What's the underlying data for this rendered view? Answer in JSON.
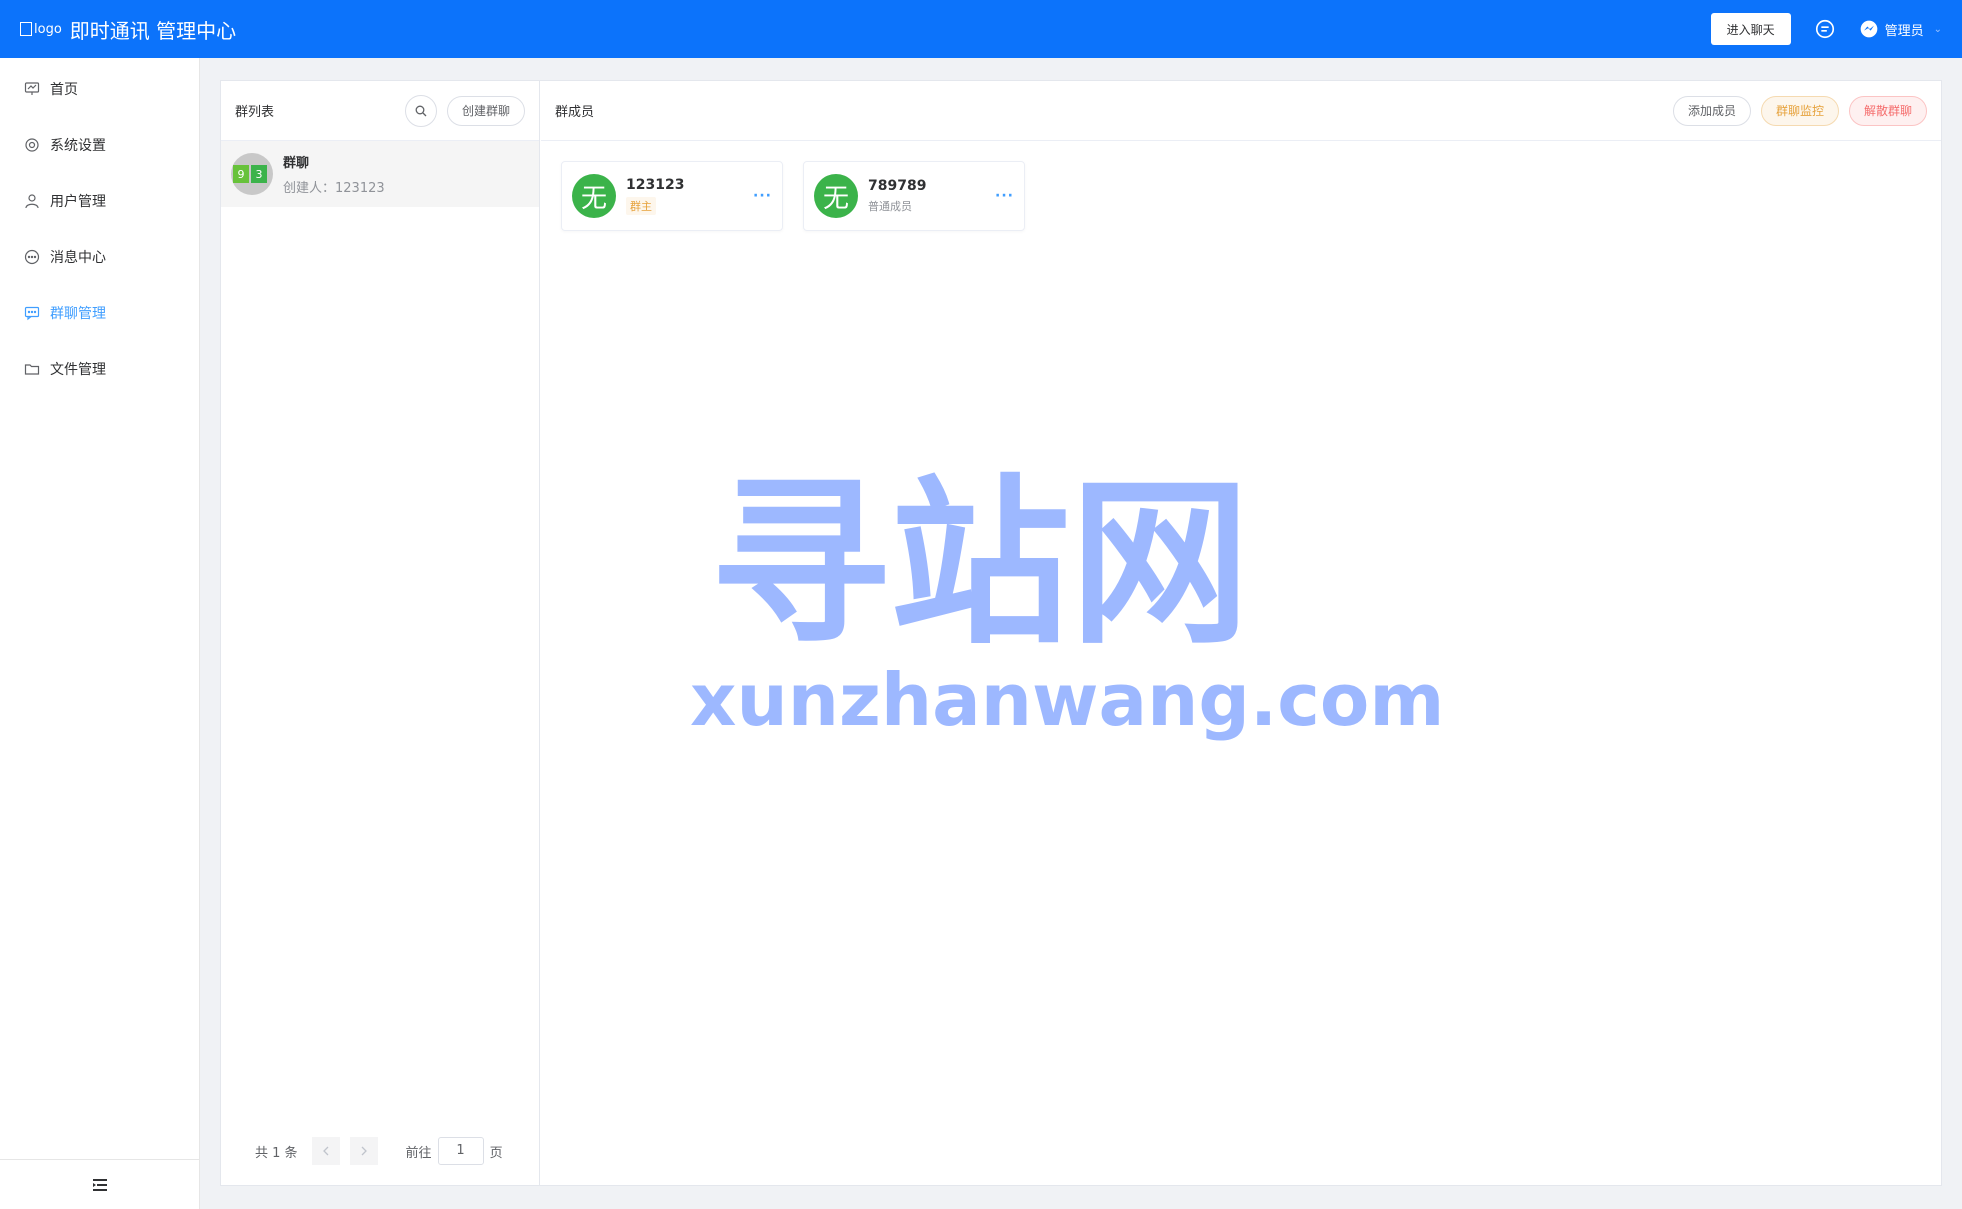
{
  "header": {
    "logo_alt": "logo",
    "title": "即时通讯 管理中心",
    "enter_chat": "进入聊天",
    "admin_name": "管理员",
    "colors": {
      "bar": "#0c73fb"
    }
  },
  "sidebar": {
    "items": [
      {
        "label": "首页",
        "icon": "chart-icon"
      },
      {
        "label": "系统设置",
        "icon": "gear-icon"
      },
      {
        "label": "用户管理",
        "icon": "user-icon"
      },
      {
        "label": "消息中心",
        "icon": "chat-bubble-icon"
      },
      {
        "label": "群聊管理",
        "icon": "group-chat-icon",
        "active": true
      },
      {
        "label": "文件管理",
        "icon": "folder-icon"
      }
    ]
  },
  "group_list": {
    "title": "群列表",
    "create_button": "创建群聊",
    "groups": [
      {
        "name": "群聊",
        "creator": "创建人：123123",
        "avatar_tiles": [
          "9",
          "3"
        ]
      }
    ],
    "pagination": {
      "total": "共 1 条",
      "goto_label": "前往",
      "page_value": "1",
      "page_suffix": "页"
    }
  },
  "members_panel": {
    "title": "群成员",
    "add_button": "添加成员",
    "monitor_button": "群聊监控",
    "dissolve_button": "解散群聊",
    "members": [
      {
        "avatar_char": "无",
        "name": "123123",
        "role": "群主",
        "is_owner": true,
        "more": "···"
      },
      {
        "avatar_char": "无",
        "name": "789789",
        "role": "普通成员",
        "is_owner": false,
        "more": "···"
      }
    ]
  },
  "watermark": {
    "cn": "寻站网",
    "en": "xunzhanwang.com"
  }
}
